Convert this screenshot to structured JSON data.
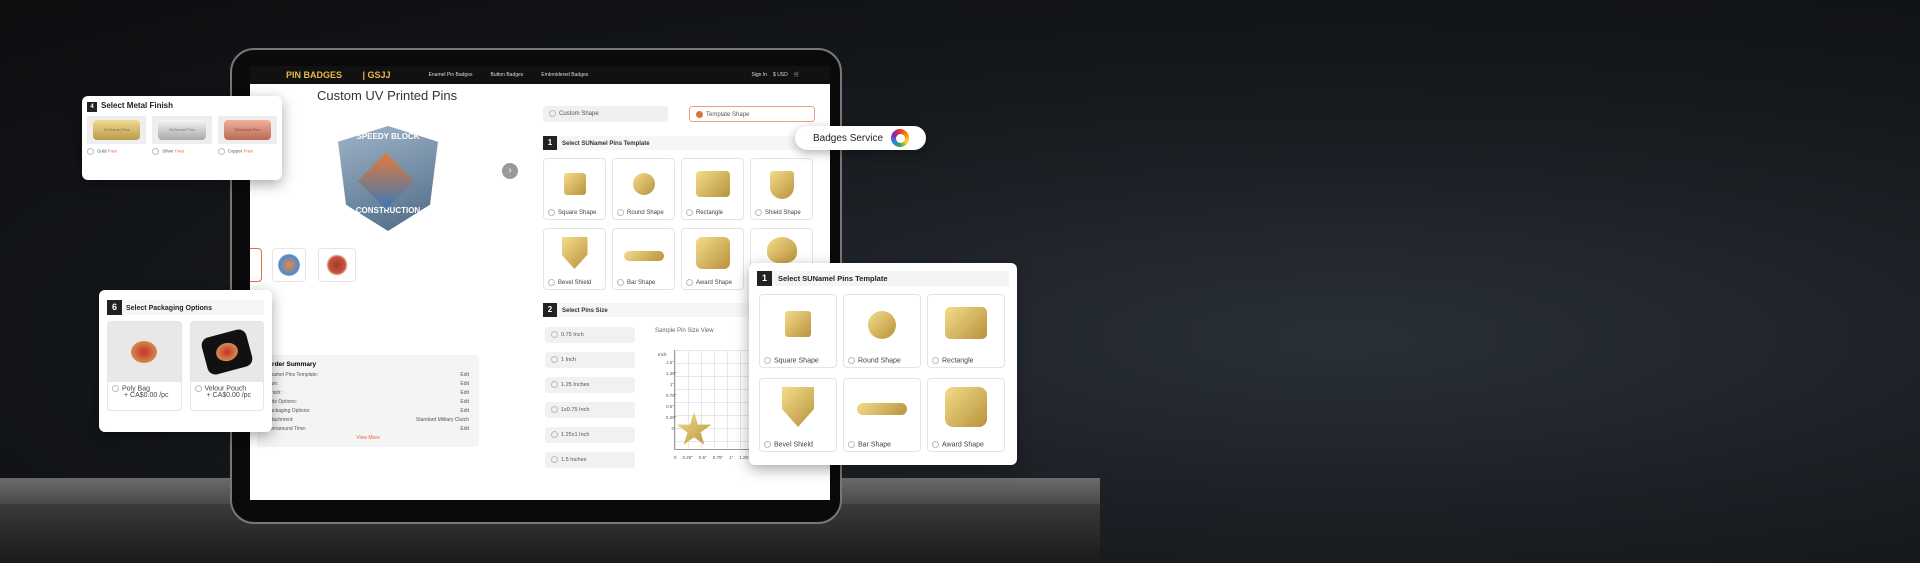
{
  "nav": {
    "logo_left": "PIN BADGES",
    "logo_right": "GSJJ",
    "links": [
      "Enamel Pin Badges",
      "Button Badges",
      "Embroidered Badges"
    ],
    "sign_in": "Sign In",
    "currency": "$ USD",
    "cart_icon": "cart-icon"
  },
  "product": {
    "title": "Custom UV Printed Pins",
    "hero_text_top": "SPEEDY BLOCK",
    "hero_text_bottom": "CONSTRUCTION"
  },
  "shape_options": [
    {
      "label": "Custom Shape",
      "selected": false
    },
    {
      "label": "Template Shape",
      "selected": true
    }
  ],
  "section1": {
    "num": "1",
    "title": "Select SUNamel Pins Template",
    "items": [
      "Square Shape",
      "Round Shape",
      "Rectangle",
      "Shield Shape",
      "Bevel Shield",
      "Bar Shape",
      "Award Shape",
      ""
    ]
  },
  "section2": {
    "num": "2",
    "title": "Select Pins Size",
    "sizes": [
      "0.75 Inch",
      "1 Inch",
      "1.25 Inches",
      "1x0.75 Inch",
      "1.25x1 Inch",
      "1.5 Inches"
    ],
    "chart_title": "Sample Pin Size View",
    "y_unit": "Inch",
    "y_ticks": [
      "1.5\"",
      "1.25\"",
      "1\"",
      "0.75\"",
      "0.5\"",
      "0.25\"",
      "0"
    ],
    "x_ticks": [
      "0",
      "0.25\"",
      "0.5\"",
      "0.75\"",
      "1\"",
      "1.25\""
    ]
  },
  "summary": {
    "title": "Order Summary",
    "rows": [
      {
        "label": "Enamel Pins Template:",
        "value": "Edit"
      },
      {
        "label": "Size:",
        "value": "Edit"
      },
      {
        "label": "Finish:",
        "value": "Edit"
      },
      {
        "label": "Side Options:",
        "value": "Edit"
      },
      {
        "label": "Packaging Options:",
        "value": "Edit"
      },
      {
        "label": "Attachment:",
        "value": "Standard Military Clutch"
      },
      {
        "label": "Turnaround Time:",
        "value": "Edit"
      }
    ],
    "view_more": "View More"
  },
  "metal_finish": {
    "num": "4",
    "title": "Select Metal Finish",
    "plate_text": "SUNamel Pins",
    "items": [
      {
        "label": "Gold",
        "price": "Free",
        "color": "#d9be6a"
      },
      {
        "label": "Silver",
        "price": "Free",
        "color": "#d8d8d8"
      },
      {
        "label": "Copper",
        "price": "Free",
        "color": "#d9927a"
      }
    ]
  },
  "packaging": {
    "num": "6",
    "title": "Select Packaging Options",
    "items": [
      {
        "label": "Poly Bag",
        "price": "+ CA$0.00 /pc"
      },
      {
        "label": "Velour Pouch",
        "price": "+ CA$0.00 /pc"
      }
    ]
  },
  "template_popup": {
    "num": "1",
    "title": "Select SUNamel Pins Template",
    "items": [
      "Square Shape",
      "Round Shape",
      "Rectangle",
      "Bevel Shield",
      "Bar Shape",
      "Award Shape"
    ]
  },
  "badge_service": {
    "label": "Badges Service"
  },
  "colors": {
    "accent": "#e0703c",
    "gold": "#d4b45c"
  }
}
